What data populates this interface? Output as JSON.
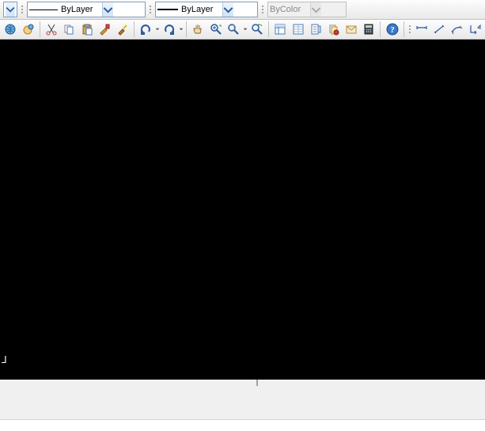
{
  "property_bar": {
    "dropdown_partial": {
      "value": ""
    },
    "linetype": {
      "value": "ByLayer"
    },
    "lineweight": {
      "value": "ByLayer"
    },
    "plotstyle": {
      "value": "ByColor",
      "disabled": true
    }
  },
  "toolbar2": {
    "buttons": [
      {
        "name": "globe-icon",
        "title": "Web"
      },
      {
        "name": "help-globe-icon",
        "title": "Communication"
      },
      {
        "name": "cut-icon",
        "title": "Cut"
      },
      {
        "name": "copy-icon",
        "title": "Copy"
      },
      {
        "name": "paste-icon",
        "title": "Paste"
      },
      {
        "name": "match-prop-icon",
        "title": "Match Properties"
      },
      {
        "name": "paintbrush-icon",
        "title": "Block Editor"
      },
      {
        "name": "undo-icon",
        "title": "Undo"
      },
      {
        "name": "redo-icon",
        "title": "Redo"
      },
      {
        "name": "pan-icon",
        "title": "Pan"
      },
      {
        "name": "zoom-realtime-icon",
        "title": "Zoom Realtime"
      },
      {
        "name": "zoom-window-icon",
        "title": "Zoom Window"
      },
      {
        "name": "zoom-previous-icon",
        "title": "Zoom Previous"
      },
      {
        "name": "properties-icon",
        "title": "Properties"
      },
      {
        "name": "design-center-icon",
        "title": "DesignCenter"
      },
      {
        "name": "tool-palettes-icon",
        "title": "Tool Palettes"
      },
      {
        "name": "sheet-set-icon",
        "title": "Sheet Set Manager"
      },
      {
        "name": "markup-icon",
        "title": "Markup Set Manager"
      },
      {
        "name": "quickcalc-icon",
        "title": "QuickCalc"
      },
      {
        "name": "help-icon",
        "title": "Help"
      },
      {
        "name": "dim-linear-icon",
        "title": "Dimension Linear"
      },
      {
        "name": "dim-aligned-icon",
        "title": "Dimension Aligned"
      },
      {
        "name": "dim-arc-icon",
        "title": "Dimension Arc"
      },
      {
        "name": "dim-ordinate-icon",
        "title": "Dimension Ordinate"
      }
    ]
  },
  "cursor": {
    "glyph": "⅃"
  }
}
